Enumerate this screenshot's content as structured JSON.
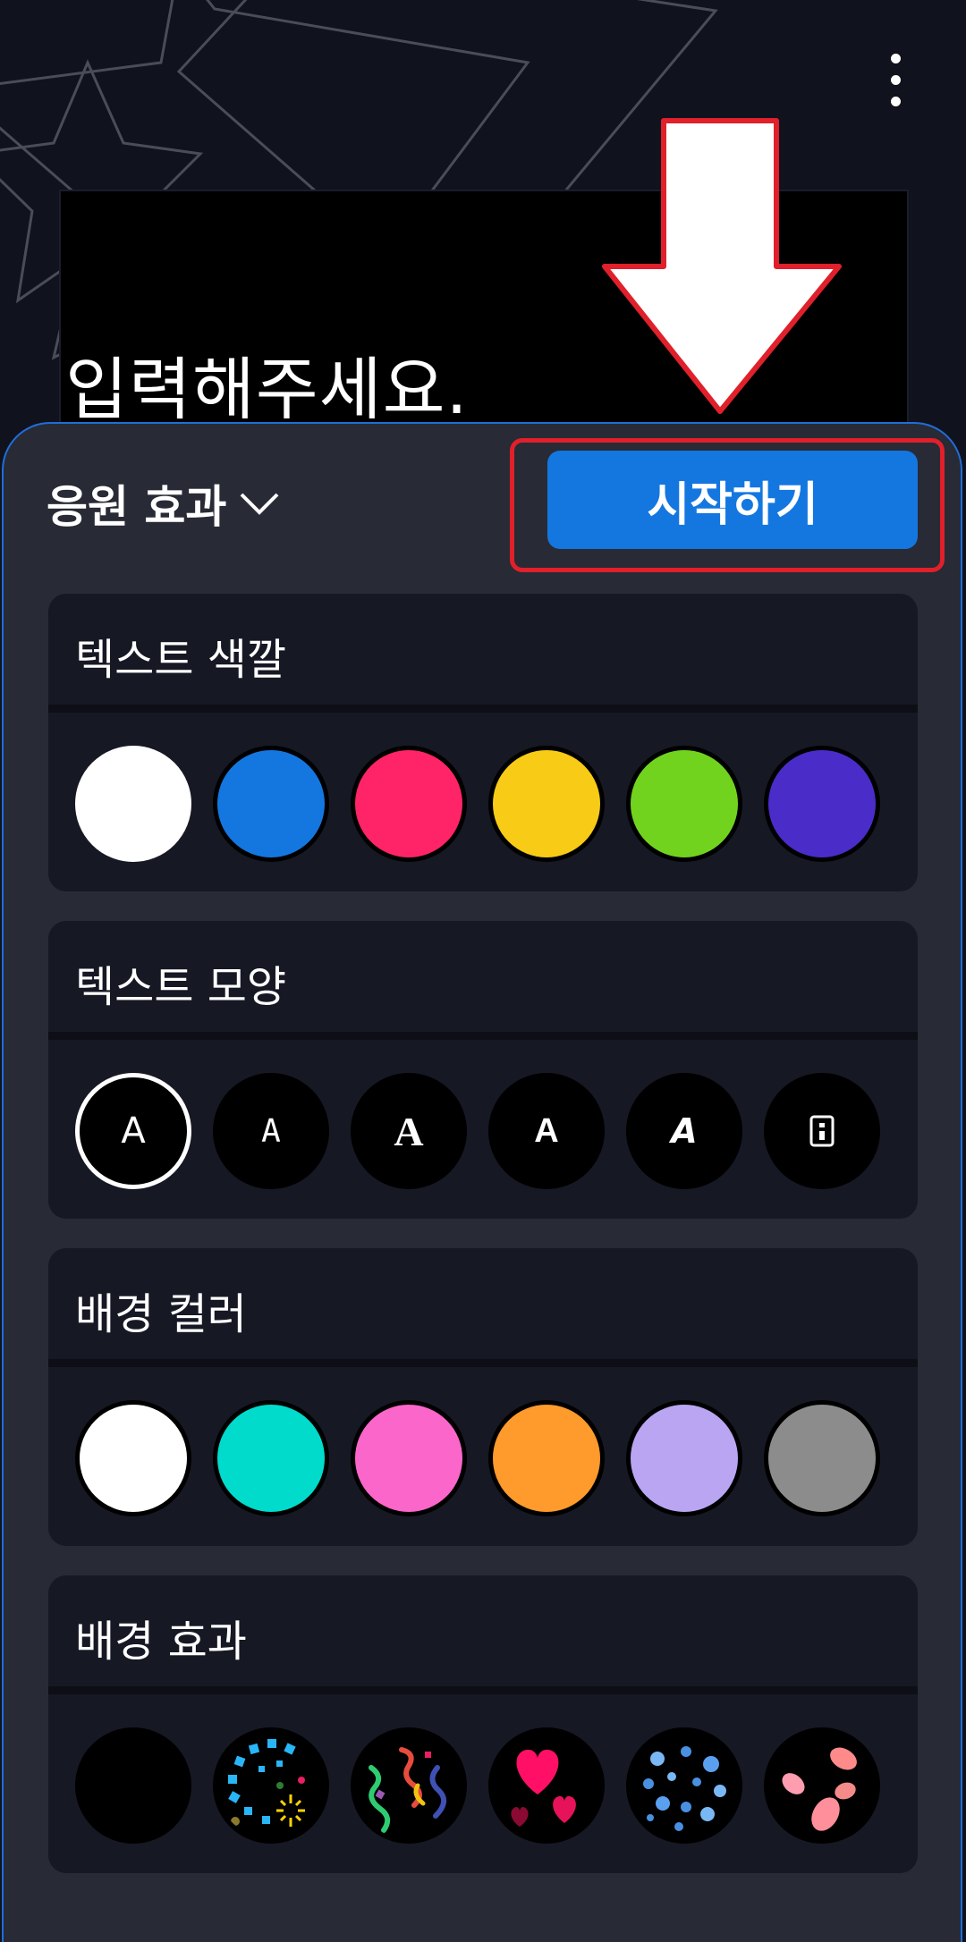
{
  "preview": {
    "text": "입력해주세요."
  },
  "header": {
    "effect_label": "응원 효과",
    "start_label": "시작하기"
  },
  "sections": [
    {
      "title": "텍스트 색깔",
      "swatches": [
        "#ffffff",
        "#1477e0",
        "#ff2467",
        "#f8cb16",
        "#72d31f",
        "#4a2dc8"
      ]
    },
    {
      "title": "텍스트 모양",
      "font_samples": [
        "A",
        "A",
        "A",
        "A",
        "A",
        "A"
      ]
    },
    {
      "title": "배경 컬러",
      "swatches": [
        "#ffffff",
        "#00dbcc",
        "#fb66cb",
        "#ff9a2c",
        "#b9a5f2",
        "#8c8c8c"
      ]
    },
    {
      "title": "배경 효과",
      "effects": [
        "none-effect-icon",
        "sparkle-burst-icon",
        "confetti-streamers-icon",
        "hearts-icon",
        "bubbles-icon",
        "petals-icon"
      ]
    }
  ],
  "colors": {
    "accent": "#1477e0",
    "annotation": "#e0202a",
    "sheet_bg": "#282a35",
    "card_bg": "#161824"
  }
}
